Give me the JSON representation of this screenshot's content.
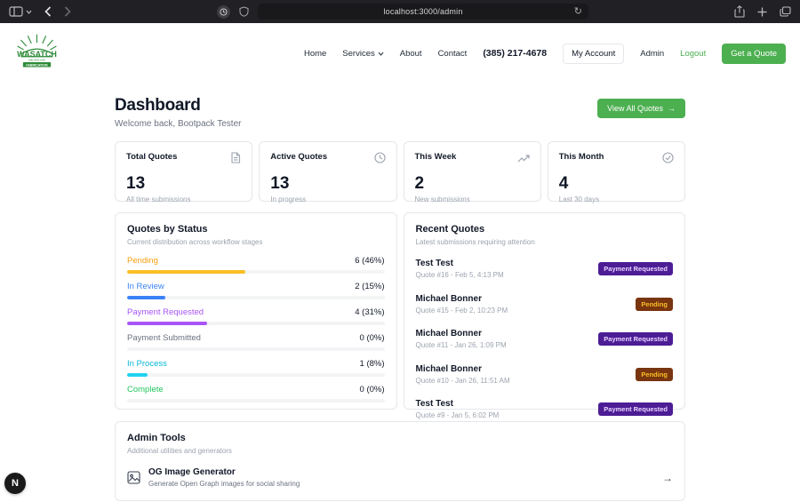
{
  "browser": {
    "url": "localhost:3000/admin"
  },
  "nav": {
    "logo_lines": {
      "top": "WASATCH",
      "mid": "WELDING AND",
      "bottom": "FABRICATION"
    },
    "items": [
      {
        "label": "Home",
        "chevron": false
      },
      {
        "label": "Services",
        "chevron": true
      },
      {
        "label": "About",
        "chevron": false
      },
      {
        "label": "Contact",
        "chevron": false
      }
    ],
    "phone": "(385) 217-4678",
    "my_account": "My Account",
    "admin": "Admin",
    "logout": "Logout",
    "cta": "Get a Quote"
  },
  "header": {
    "title": "Dashboard",
    "subtitle": "Welcome back, Bootpack Tester",
    "view_all": "View All Quotes",
    "view_all_arrow": "→"
  },
  "stats": [
    {
      "label": "Total Quotes",
      "value": "13",
      "sub": "All time submissions",
      "icon": "document-icon"
    },
    {
      "label": "Active Quotes",
      "value": "13",
      "sub": "In progress",
      "icon": "clock-icon"
    },
    {
      "label": "This Week",
      "value": "2",
      "sub": "New submissions",
      "icon": "trending-up-icon"
    },
    {
      "label": "This Month",
      "value": "4",
      "sub": "Last 30 days",
      "icon": "check-circle-icon"
    }
  ],
  "status_panel": {
    "title": "Quotes by Status",
    "subtitle": "Current distribution across workflow stages",
    "rows": [
      {
        "label": "Pending",
        "value": "6 (46%)",
        "pct": 46,
        "label_color": "#f59e0b",
        "bar_color": "#fbbf24"
      },
      {
        "label": "In Review",
        "value": "2 (15%)",
        "pct": 15,
        "label_color": "#3b82f6",
        "bar_color": "#3b82f6"
      },
      {
        "label": "Payment Requested",
        "value": "4 (31%)",
        "pct": 31,
        "label_color": "#a855f7",
        "bar_color": "#a855f7"
      },
      {
        "label": "Payment Submitted",
        "value": "0 (0%)",
        "pct": 0,
        "label_color": "#6b7280",
        "bar_color": "#6b7280"
      },
      {
        "label": "In Process",
        "value": "1 (8%)",
        "pct": 8,
        "label_color": "#06b6d4",
        "bar_color": "#22d3ee"
      },
      {
        "label": "Complete",
        "value": "0 (0%)",
        "pct": 0,
        "label_color": "#22c55e",
        "bar_color": "#22c55e"
      }
    ]
  },
  "recent_panel": {
    "title": "Recent Quotes",
    "subtitle": "Latest submissions requiring attention",
    "rows": [
      {
        "name": "Test Test",
        "meta": "Quote #16 - Feb 5, 4:13 PM",
        "badge": "Payment Requested",
        "badge_type": "purple"
      },
      {
        "name": "Michael Bonner",
        "meta": "Quote #15 - Feb 2, 10:23 PM",
        "badge": "Pending",
        "badge_type": "amber"
      },
      {
        "name": "Michael Bonner",
        "meta": "Quote #11 - Jan 26, 1:09 PM",
        "badge": "Payment Requested",
        "badge_type": "purple"
      },
      {
        "name": "Michael Bonner",
        "meta": "Quote #10 - Jan 26, 11:51 AM",
        "badge": "Pending",
        "badge_type": "amber"
      },
      {
        "name": "Test Test",
        "meta": "Quote #9 - Jan 5, 6:02 PM",
        "badge": "Payment Requested",
        "badge_type": "purple"
      }
    ]
  },
  "admin_tools": {
    "title": "Admin Tools",
    "subtitle": "Additional utilities and generators",
    "items": [
      {
        "title": "OG Image Generator",
        "desc": "Generate Open Graph images for social sharing",
        "arrow": "→"
      }
    ]
  },
  "colors": {
    "accent_green": "#4caf50",
    "chrome_bg": "#212125",
    "border": "#e5e7eb",
    "muted_text": "#9ca3af"
  },
  "misc": {
    "next_indicator": "N"
  }
}
